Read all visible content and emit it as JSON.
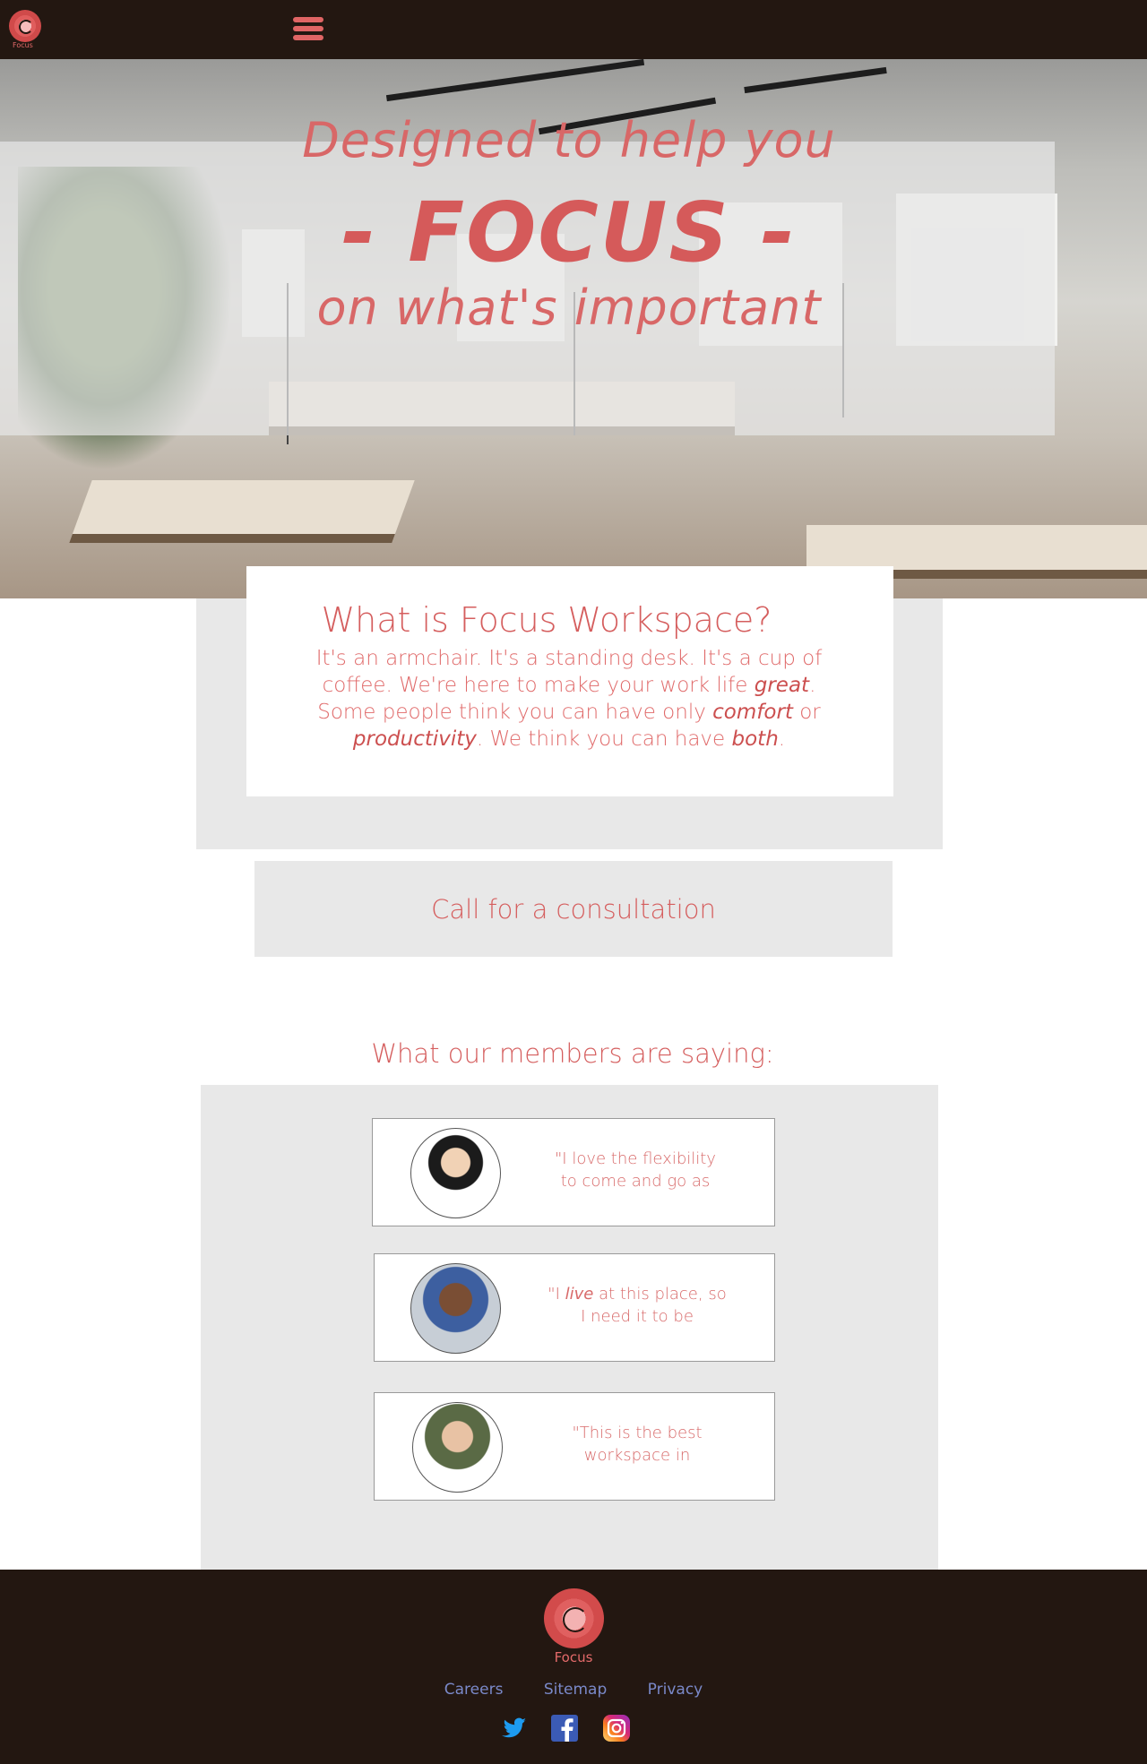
{
  "header": {
    "logo_label": "Focus"
  },
  "hero": {
    "line1": "Designed to help you",
    "line2": "- FOCUS -",
    "line3": "on what's important"
  },
  "about": {
    "title": "What is Focus Workspace?",
    "body_part1": "It's an armchair. It's a standing desk. It's a cup of coffee. We're here to make your work life ",
    "em1": "great",
    "body_part2": ". Some people think you can have only ",
    "em2": "comfort",
    "body_part3": " or ",
    "em3": "productivity",
    "body_part4": ". We think you can have ",
    "em4": "both",
    "body_part5": "."
  },
  "cta": {
    "label": "Call for a consultation"
  },
  "testimonials": {
    "title": "What our members are saying:",
    "items": [
      {
        "quote": "\"I love the flexibility to come and go as"
      },
      {
        "quote_pre": "\"I ",
        "quote_em": "live",
        "quote_post": " at this place, so I need it to be"
      },
      {
        "quote": "\"This is the best workspace in"
      }
    ]
  },
  "footer": {
    "logo_label": "Focus",
    "links": [
      "Careers",
      "Sitemap",
      "Privacy"
    ],
    "social": [
      "twitter-icon",
      "facebook-icon",
      "instagram-icon"
    ]
  },
  "colors": {
    "header_bg": "#231711",
    "accent": "#d55e5e",
    "panel_gray": "#e8e8e8",
    "link": "#7a89c9"
  }
}
